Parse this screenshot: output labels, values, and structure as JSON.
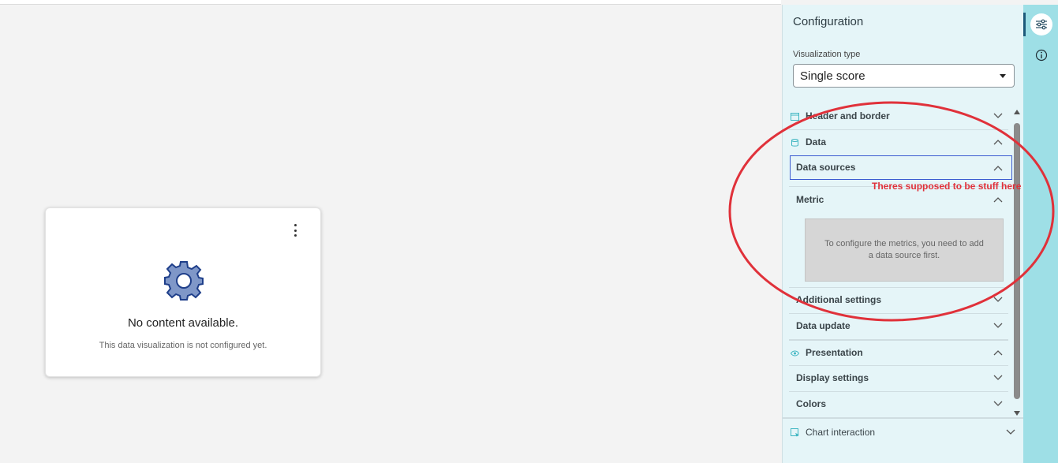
{
  "card": {
    "title": "No content available.",
    "subtitle": "This data visualization is not configured yet.",
    "menu_icon": "kebab-menu-icon",
    "illustration_icon": "gear-icon"
  },
  "config": {
    "title": "Configuration",
    "viz_type_label": "Visualization type",
    "viz_type_value": "Single score",
    "sections": {
      "header_border": "Header and border",
      "data": "Data",
      "data_sources": "Data sources",
      "metric": "Metric",
      "metric_empty": "To configure the metrics, you need to add a data source first.",
      "additional_settings": "Additional settings",
      "data_update": "Data update",
      "presentation": "Presentation",
      "display_settings": "Display settings",
      "colors": "Colors",
      "chart_interaction": "Chart interaction"
    }
  },
  "rail": {
    "settings_icon": "sliders-icon",
    "info_icon": "info-icon"
  },
  "annotation": {
    "text": "Theres supposed to be stuff here",
    "color": "#e0313a"
  },
  "colors": {
    "panel_bg": "#e5f5f8",
    "rail_bg": "#9edfe6",
    "focus_border": "#3b5bd0",
    "icon_teal": "#3fb6c2"
  }
}
